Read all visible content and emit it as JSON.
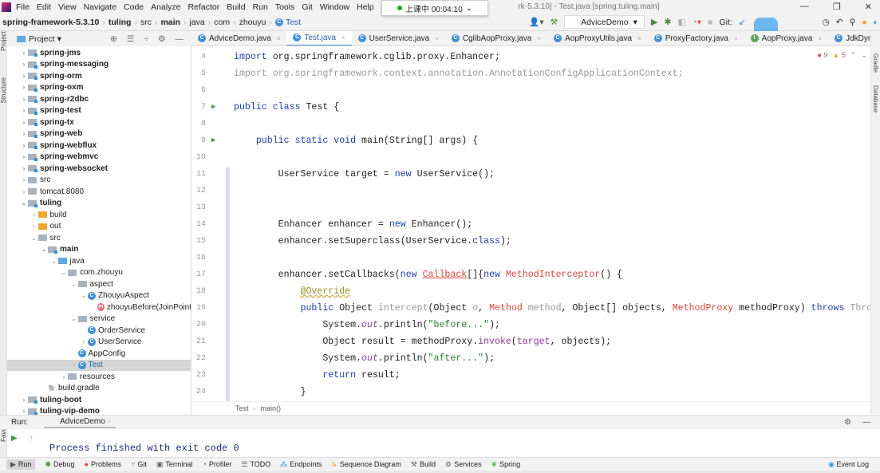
{
  "menu": {
    "items": [
      "File",
      "Edit",
      "View",
      "Navigate",
      "Code",
      "Analyze",
      "Refactor",
      "Build",
      "Run",
      "Tools",
      "Git",
      "Window",
      "Help"
    ],
    "title_left": "sprin",
    "title_right": "rk-5.3.10] - Test.java [spring.tuling.main]"
  },
  "timer": {
    "label": "上课中 00:04:10",
    "chevron": "⌄"
  },
  "window": {
    "minimize": "—",
    "restore": "❐",
    "close": "✕"
  },
  "breadcrumb": [
    "spring-framework-5.3.10",
    "tuling",
    "src",
    "main",
    "java",
    "com",
    "zhouyu",
    "Test"
  ],
  "toolbar": {
    "run_config": "AdviceDemo",
    "git_label": "Git:"
  },
  "project": {
    "title": "Project ▾",
    "tree": [
      {
        "label": "spring-jms",
        "depth": 0,
        "arrow": "›",
        "icon": "module",
        "bold": true
      },
      {
        "label": "spring-messaging",
        "depth": 0,
        "arrow": "›",
        "icon": "module",
        "bold": true
      },
      {
        "label": "spring-orm",
        "depth": 0,
        "arrow": "›",
        "icon": "module",
        "bold": true
      },
      {
        "label": "spring-oxm",
        "depth": 0,
        "arrow": "›",
        "icon": "module",
        "bold": true
      },
      {
        "label": "spring-r2dbc",
        "depth": 0,
        "arrow": "›",
        "icon": "module",
        "bold": true
      },
      {
        "label": "spring-test",
        "depth": 0,
        "arrow": "›",
        "icon": "module",
        "bold": true
      },
      {
        "label": "spring-tx",
        "depth": 0,
        "arrow": "›",
        "icon": "module",
        "bold": true
      },
      {
        "label": "spring-web",
        "depth": 0,
        "arrow": "›",
        "icon": "module",
        "bold": true
      },
      {
        "label": "spring-webflux",
        "depth": 0,
        "arrow": "›",
        "icon": "module",
        "bold": true
      },
      {
        "label": "spring-webmvc",
        "depth": 0,
        "arrow": "›",
        "icon": "module",
        "bold": true
      },
      {
        "label": "spring-websocket",
        "depth": 0,
        "arrow": "›",
        "icon": "module",
        "bold": true
      },
      {
        "label": "src",
        "depth": 0,
        "arrow": "›",
        "icon": "folder"
      },
      {
        "label": "tomcat.8080",
        "depth": 0,
        "arrow": "›",
        "icon": "folder"
      },
      {
        "label": "tuling",
        "depth": 0,
        "arrow": "⌄",
        "icon": "module",
        "bold": true
      },
      {
        "label": "build",
        "depth": 1,
        "arrow": "›",
        "icon": "orange"
      },
      {
        "label": "out",
        "depth": 1,
        "arrow": "›",
        "icon": "orange"
      },
      {
        "label": "src",
        "depth": 1,
        "arrow": "⌄",
        "icon": "folder"
      },
      {
        "label": "main",
        "depth": 2,
        "arrow": "⌄",
        "icon": "module",
        "bold": true
      },
      {
        "label": "java",
        "depth": 3,
        "arrow": "⌄",
        "icon": "blue"
      },
      {
        "label": "com.zhouyu",
        "depth": 4,
        "arrow": "⌄",
        "icon": "folder"
      },
      {
        "label": "aspect",
        "depth": 5,
        "arrow": "⌄",
        "icon": "folder"
      },
      {
        "label": "ZhouyuAspect",
        "depth": 6,
        "arrow": "⌄",
        "icon": "class"
      },
      {
        "label": "zhouyuBefore(JoinPoint",
        "depth": 7,
        "arrow": "",
        "icon": "method"
      },
      {
        "label": "service",
        "depth": 5,
        "arrow": "⌄",
        "icon": "folder"
      },
      {
        "label": "OrderService",
        "depth": 6,
        "arrow": "",
        "icon": "class"
      },
      {
        "label": "UserService",
        "depth": 6,
        "arrow": "›",
        "icon": "class"
      },
      {
        "label": "AppConfig",
        "depth": 5,
        "arrow": "",
        "icon": "class"
      },
      {
        "label": "Test",
        "depth": 5,
        "arrow": "›",
        "icon": "class",
        "selected": true
      },
      {
        "label": "resources",
        "depth": 4,
        "arrow": "›",
        "icon": "folder"
      },
      {
        "label": "build.gradle",
        "depth": 2,
        "arrow": "",
        "icon": "gradle"
      },
      {
        "label": "tuling-boot",
        "depth": 0,
        "arrow": "›",
        "icon": "module",
        "bold": true
      },
      {
        "label": "tuling-vip-demo",
        "depth": 0,
        "arrow": "›",
        "icon": "module",
        "bold": true
      }
    ]
  },
  "tabs": [
    {
      "label": "AdviceDemo.java",
      "icon": "C"
    },
    {
      "label": "Test.java",
      "icon": "C",
      "active": true
    },
    {
      "label": "UserService.java",
      "icon": "C"
    },
    {
      "label": "CglibAopProxy.java",
      "icon": "C"
    },
    {
      "label": "AopProxyUtils.java",
      "icon": "C"
    },
    {
      "label": "ProxyFactory.java",
      "icon": "C"
    },
    {
      "label": "AopProxy.java",
      "icon": "I"
    },
    {
      "label": "JdkDynamicAopPro",
      "icon": "C"
    }
  ],
  "inspections": {
    "errors": "9",
    "warnings": "5"
  },
  "code": [
    {
      "n": "4",
      "t": [
        [
          "kw",
          "import "
        ],
        [
          "",
          "org.springframework.cglib.proxy.Enhancer;"
        ]
      ]
    },
    {
      "n": "5",
      "t": [
        [
          "gray",
          "import org.springframework.context.annotation.AnnotationConfigApplicationContext;"
        ]
      ]
    },
    {
      "n": "6",
      "t": []
    },
    {
      "n": "7",
      "run": true,
      "t": [
        [
          "kw",
          "public class "
        ],
        [
          "",
          "Test {"
        ]
      ]
    },
    {
      "n": "8",
      "t": []
    },
    {
      "n": "9",
      "run": true,
      "t": [
        [
          "",
          "    "
        ],
        [
          "kw",
          "public static void "
        ],
        [
          "",
          "main(String[] args) {"
        ]
      ]
    },
    {
      "n": "10",
      "t": []
    },
    {
      "n": "11",
      "t": [
        [
          "",
          "        UserService target = "
        ],
        [
          "kw",
          "new "
        ],
        [
          "",
          "UserService();"
        ]
      ]
    },
    {
      "n": "12",
      "t": []
    },
    {
      "n": "13",
      "t": []
    },
    {
      "n": "14",
      "t": [
        [
          "",
          "        Enhancer enhancer = "
        ],
        [
          "kw",
          "new "
        ],
        [
          "",
          "Enhancer();"
        ]
      ]
    },
    {
      "n": "15",
      "t": [
        [
          "",
          "        enhancer.setSuperclass(UserService."
        ],
        [
          "kw",
          "class"
        ],
        [
          "",
          ");"
        ]
      ]
    },
    {
      "n": "16",
      "t": []
    },
    {
      "n": "17",
      "t": [
        [
          "",
          "        enhancer.setCallbacks("
        ],
        [
          "kw",
          "new "
        ],
        [
          "und",
          "Callback"
        ],
        [
          "",
          "[]{"
        ],
        [
          "kw",
          "new "
        ],
        [
          "red",
          "MethodInterceptor"
        ],
        [
          "",
          "() {"
        ]
      ]
    },
    {
      "n": "18",
      "t": [
        [
          "",
          "            "
        ],
        [
          "ann",
          "@Override"
        ]
      ]
    },
    {
      "n": "19",
      "t": [
        [
          "",
          "            "
        ],
        [
          "kw",
          "public "
        ],
        [
          "",
          "Object "
        ],
        [
          "gray",
          "intercept"
        ],
        [
          "",
          "(Object "
        ],
        [
          "gray",
          "o"
        ],
        [
          "",
          ", "
        ],
        [
          "red",
          "Method "
        ],
        [
          "gray",
          "method"
        ],
        [
          "",
          ", Object[] objects, "
        ],
        [
          "red",
          "MethodProxy "
        ],
        [
          "",
          "methodProxy) "
        ],
        [
          "kw",
          "throws "
        ],
        [
          "gray",
          "Thro"
        ]
      ]
    },
    {
      "n": "20",
      "t": [
        [
          "",
          "                System."
        ],
        [
          "it",
          "out"
        ],
        [
          "",
          ".println("
        ],
        [
          "str",
          "\"before...\""
        ],
        [
          "",
          ");"
        ]
      ]
    },
    {
      "n": "21",
      "t": [
        [
          "",
          "                Object result = methodProxy."
        ],
        [
          "purple",
          "invoke"
        ],
        [
          "",
          "("
        ],
        [
          "purple",
          "target"
        ],
        [
          "",
          ", objects);"
        ]
      ]
    },
    {
      "n": "22",
      "t": [
        [
          "",
          "                System."
        ],
        [
          "it",
          "out"
        ],
        [
          "",
          ".println("
        ],
        [
          "str",
          "\"after...\""
        ],
        [
          "",
          ");"
        ]
      ]
    },
    {
      "n": "23",
      "t": [
        [
          "",
          "                "
        ],
        [
          "kw",
          "return "
        ],
        [
          "",
          "result;"
        ]
      ]
    },
    {
      "n": "24",
      "t": [
        [
          "",
          "            }"
        ]
      ]
    }
  ],
  "editor_breadcrumb": [
    "Test",
    "main()"
  ],
  "run": {
    "label": "Run:",
    "tab": "AdviceDemo",
    "output": "Process finished with exit code 0"
  },
  "side": {
    "project": "Project",
    "structure": "Structure",
    "favorites": "Favorites",
    "gradle": "Gradle",
    "database": "Database"
  },
  "tool_windows": [
    {
      "label": "Run",
      "icon": "▶",
      "active": true
    },
    {
      "label": "Debug",
      "icon": "✱"
    },
    {
      "label": "Problems",
      "icon": "●"
    },
    {
      "label": "Git",
      "icon": "⑂"
    },
    {
      "label": "Terminal",
      "icon": "▣"
    },
    {
      "label": "Profiler",
      "icon": "◔"
    },
    {
      "label": "TODO",
      "icon": "☰"
    },
    {
      "label": "Endpoints",
      "icon": "⁂"
    },
    {
      "label": "Sequence Diagram",
      "icon": "↳"
    },
    {
      "label": "Build",
      "icon": "⚒"
    },
    {
      "label": "Services",
      "icon": "⚙"
    },
    {
      "label": "Spring",
      "icon": "❦"
    }
  ],
  "event_log": "Event Log"
}
